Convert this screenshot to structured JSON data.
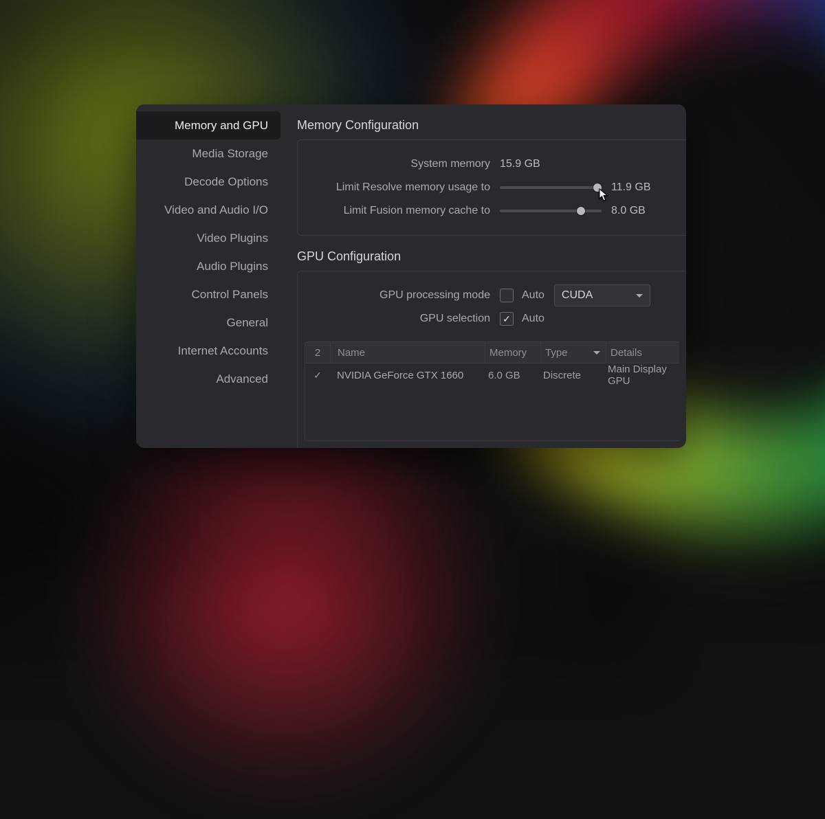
{
  "sidebar": {
    "items": [
      "Memory and GPU",
      "Media Storage",
      "Decode Options",
      "Video and Audio I/O",
      "Video Plugins",
      "Audio Plugins",
      "Control Panels",
      "General",
      "Internet Accounts",
      "Advanced"
    ],
    "active_index": 0
  },
  "memory": {
    "section_title": "Memory Configuration",
    "system_label": "System memory",
    "system_value": "15.9 GB",
    "resolve_label": "Limit Resolve memory usage to",
    "resolve_value": "11.9 GB",
    "resolve_slider_pct": 96,
    "fusion_label": "Limit Fusion memory cache to",
    "fusion_value": "8.0 GB",
    "fusion_slider_pct": 80
  },
  "gpu": {
    "section_title": "GPU Configuration",
    "mode_label": "GPU processing mode",
    "mode_auto_label": "Auto",
    "mode_auto_checked": false,
    "mode_value": "CUDA",
    "selection_label": "GPU selection",
    "selection_auto_label": "Auto",
    "selection_auto_checked": true,
    "table": {
      "headers": {
        "count": "2",
        "name": "Name",
        "memory": "Memory",
        "type": "Type",
        "details": "Details"
      },
      "rows": [
        {
          "checked": true,
          "name": "NVIDIA GeForce GTX 1660",
          "memory": "6.0 GB",
          "type": "Discrete",
          "details": "Main Display GPU"
        }
      ]
    }
  }
}
